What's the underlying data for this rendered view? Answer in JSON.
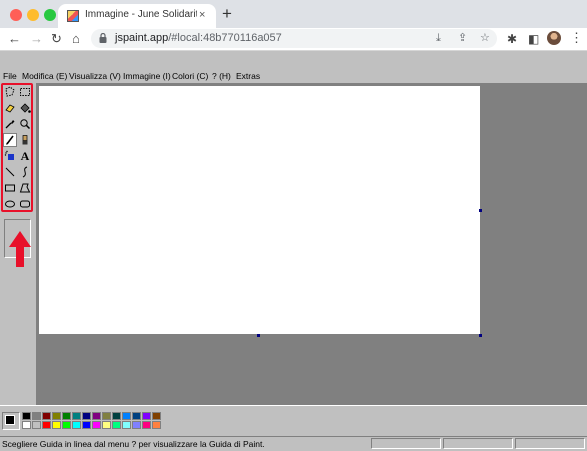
{
  "browser": {
    "tab": {
      "title": "Immagine - June Solidarity Paint",
      "close": "×"
    },
    "new_tab": "+",
    "nav": {
      "back": "←",
      "forward": "→",
      "reload": "↻",
      "home": "⌂"
    },
    "address": {
      "host": "jspaint.app",
      "path": "/#local:48b770116a057"
    },
    "omnibox_icons": {
      "install": "⤓",
      "share": "⇪",
      "bookmark": "☆"
    },
    "extensions": {
      "puzzle": "✱",
      "side_panel": "◧",
      "menu": "⋮"
    }
  },
  "menubar": {
    "items": [
      {
        "label": "File"
      },
      {
        "label": "Modifica (E)"
      },
      {
        "label": "Visualizza (V)"
      },
      {
        "label": "Immagine (I)"
      },
      {
        "label": "Colori (C)"
      },
      {
        "label": "? (H)"
      },
      {
        "label": "Extras"
      }
    ]
  },
  "tools": [
    {
      "name": "free-form-select",
      "glyph": "✧"
    },
    {
      "name": "select",
      "glyph": "⬚"
    },
    {
      "name": "eraser",
      "glyph": "▱"
    },
    {
      "name": "fill",
      "glyph": "◈"
    },
    {
      "name": "pick-color",
      "glyph": "✎"
    },
    {
      "name": "magnifier",
      "glyph": "⌕"
    },
    {
      "name": "pencil",
      "glyph": "✏"
    },
    {
      "name": "brush",
      "glyph": "♜"
    },
    {
      "name": "airbrush",
      "glyph": "⛆"
    },
    {
      "name": "text",
      "glyph": "A"
    },
    {
      "name": "line",
      "glyph": "╲"
    },
    {
      "name": "curve",
      "glyph": "∫"
    },
    {
      "name": "rectangle",
      "glyph": "▭"
    },
    {
      "name": "polygon",
      "glyph": "⏢"
    },
    {
      "name": "ellipse",
      "glyph": "⬭"
    },
    {
      "name": "rounded-rectangle",
      "glyph": "▢"
    }
  ],
  "palette": {
    "foreground": "#000000",
    "background": "#ffffff",
    "top_row": [
      "#000000",
      "#808080",
      "#800000",
      "#808000",
      "#008000",
      "#008080",
      "#000080",
      "#800080",
      "#808040",
      "#004040",
      "#0080ff",
      "#004080",
      "#8000ff",
      "#804000"
    ],
    "bottom_row": [
      "#ffffff",
      "#c0c0c0",
      "#ff0000",
      "#ffff00",
      "#00ff00",
      "#00ffff",
      "#0000ff",
      "#ff00ff",
      "#ffff80",
      "#00ff80",
      "#80ffff",
      "#8080ff",
      "#ff0080",
      "#ff8040"
    ]
  },
  "status": {
    "text": "Scegliere Guida in linea dal menu ? per visualizzare la Guida di Paint."
  },
  "annotation": {
    "highlight_color": "#e8102a"
  }
}
